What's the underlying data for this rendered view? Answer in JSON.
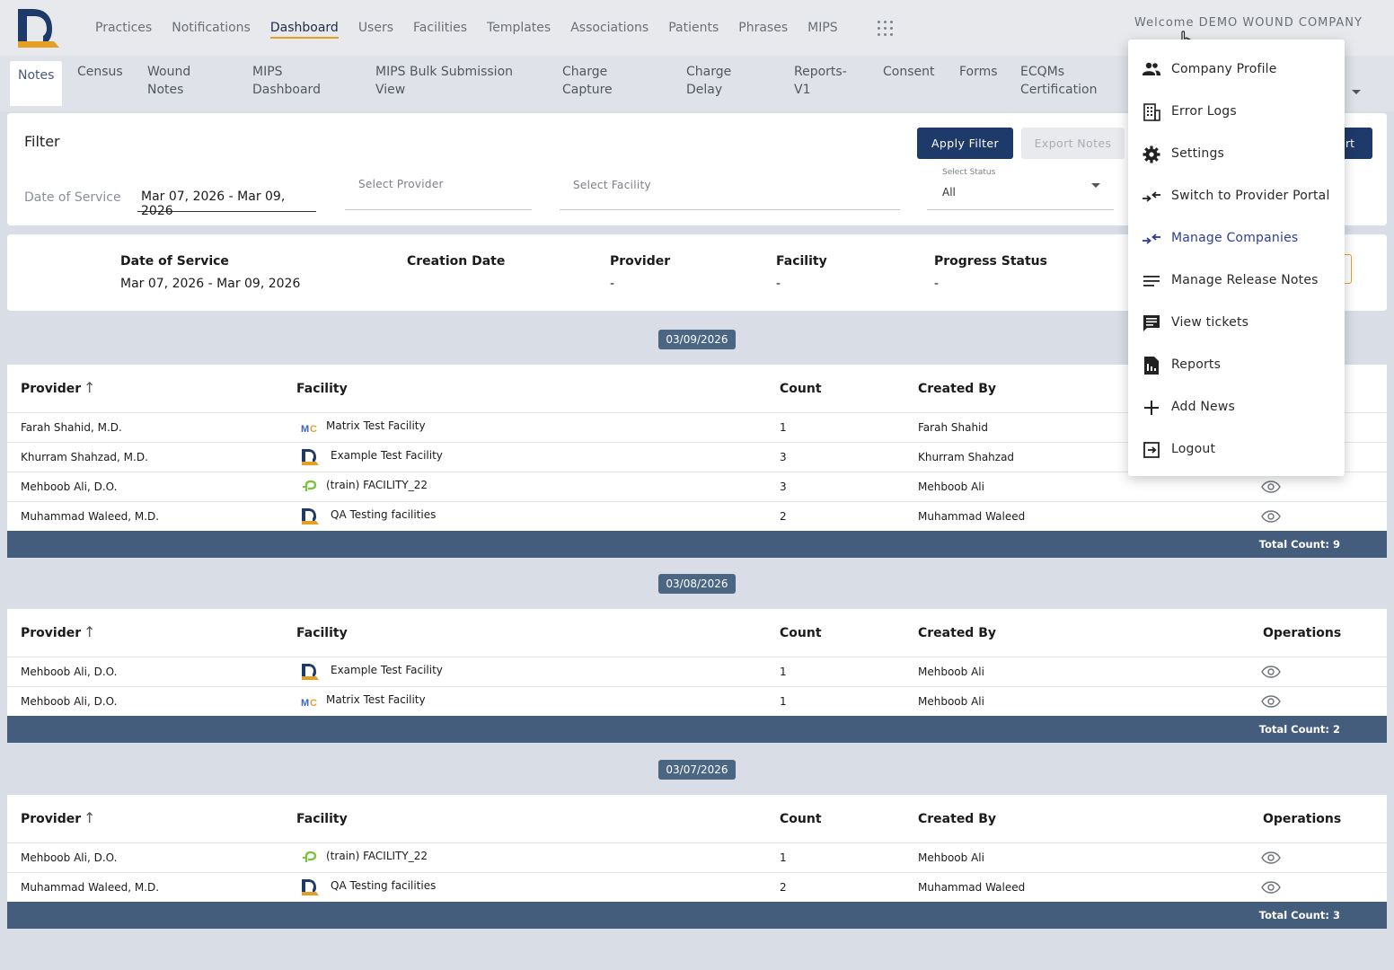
{
  "nav": {
    "items": [
      "Practices",
      "Notifications",
      "Dashboard",
      "Users",
      "Facilities",
      "Templates",
      "Associations",
      "Patients",
      "Phrases",
      "MIPS"
    ],
    "active": "Dashboard",
    "welcome": "Welcome DEMO WOUND COMPANY"
  },
  "subnav": {
    "tabs": [
      "Notes",
      "Census",
      "Wound\nNotes",
      "MIPS\nDashboard",
      "MIPS Bulk Submission\nView",
      "Charge\nCapture",
      "Charge\nDelay",
      "Reports-\nV1",
      "Consent",
      "Forms",
      "ECQMs\nCertification"
    ],
    "active": "Notes"
  },
  "filter": {
    "title": "Filter",
    "apply_label": "Apply Filter",
    "export_label": "Export Notes",
    "import_label": "rt",
    "dos_label": "Date of Service",
    "dos_value": "Mar 07, 2026 - Mar 09, 2026",
    "provider_placeholder": "Select Provider",
    "facility_placeholder": "Select Facility",
    "status_label": "Select Status",
    "status_value": "All"
  },
  "summary": {
    "dos_label": "Date of Service",
    "dos_value": "Mar 07, 2026 - Mar 09, 2026",
    "creation_label": "Creation Date",
    "provider_label": "Provider",
    "provider_value": "-",
    "facility_label": "Facility",
    "facility_value": "-",
    "progress_label": "Progress Status",
    "progress_value": "-"
  },
  "columns": {
    "provider": "Provider",
    "facility": "Facility",
    "count": "Count",
    "created_by": "Created By",
    "operations": "Operations",
    "sort_icon": "arrow-up"
  },
  "groups": [
    {
      "date": "03/09/2026",
      "total": "Total Count: 9",
      "rows": [
        {
          "provider": "Farah Shahid, M.D.",
          "facility": "Matrix Test Facility",
          "icon": "mc",
          "count": "1",
          "created_by": "Farah Shahid"
        },
        {
          "provider": "Khurram Shahzad, M.D.",
          "facility": "Example Test Facility",
          "icon": "d",
          "count": "3",
          "created_by": "Khurram Shahzad"
        },
        {
          "provider": "Mehboob Ali, D.O.",
          "facility": "(train) FACILITY_22",
          "icon": "p",
          "count": "3",
          "created_by": "Mehboob Ali"
        },
        {
          "provider": "Muhammad Waleed, M.D.",
          "facility": "QA Testing facilities",
          "icon": "d",
          "count": "2",
          "created_by": "Muhammad Waleed"
        }
      ]
    },
    {
      "date": "03/08/2026",
      "total": "Total Count: 2",
      "rows": [
        {
          "provider": "Mehboob Ali, D.O.",
          "facility": "Example Test Facility",
          "icon": "d",
          "count": "1",
          "created_by": "Mehboob Ali"
        },
        {
          "provider": "Mehboob Ali, D.O.",
          "facility": "Matrix Test Facility",
          "icon": "mc",
          "count": "1",
          "created_by": "Mehboob Ali"
        }
      ]
    },
    {
      "date": "03/07/2026",
      "total": "Total Count: 3",
      "rows": [
        {
          "provider": "Mehboob Ali, D.O.",
          "facility": "(train) FACILITY_22",
          "icon": "p",
          "count": "1",
          "created_by": "Mehboob Ali"
        },
        {
          "provider": "Muhammad Waleed, M.D.",
          "facility": "QA Testing facilities",
          "icon": "d",
          "count": "2",
          "created_by": "Muhammad Waleed"
        }
      ]
    }
  ],
  "menu": {
    "items": [
      {
        "label": "Company Profile",
        "icon": "people-icon"
      },
      {
        "label": "Error Logs",
        "icon": "building-icon"
      },
      {
        "label": "Settings",
        "icon": "gear-icon"
      },
      {
        "label": "Switch to Provider Portal",
        "icon": "switch-icon"
      },
      {
        "label": "Manage Companies",
        "icon": "switch-icon",
        "highlight": true
      },
      {
        "label": "Manage Release Notes",
        "icon": "lines-icon"
      },
      {
        "label": "View tickets",
        "icon": "chat-icon"
      },
      {
        "label": "Reports",
        "icon": "report-icon"
      },
      {
        "label": "Add News",
        "icon": "plus-icon"
      },
      {
        "label": "Logout",
        "icon": "logout-icon"
      }
    ]
  },
  "colors": {
    "primary": "#1e3a6a",
    "accent": "#e4a025",
    "table_footer": "#455d7d",
    "date_badge": "#4a6683",
    "menu_highlight": "#2d3d9a"
  }
}
